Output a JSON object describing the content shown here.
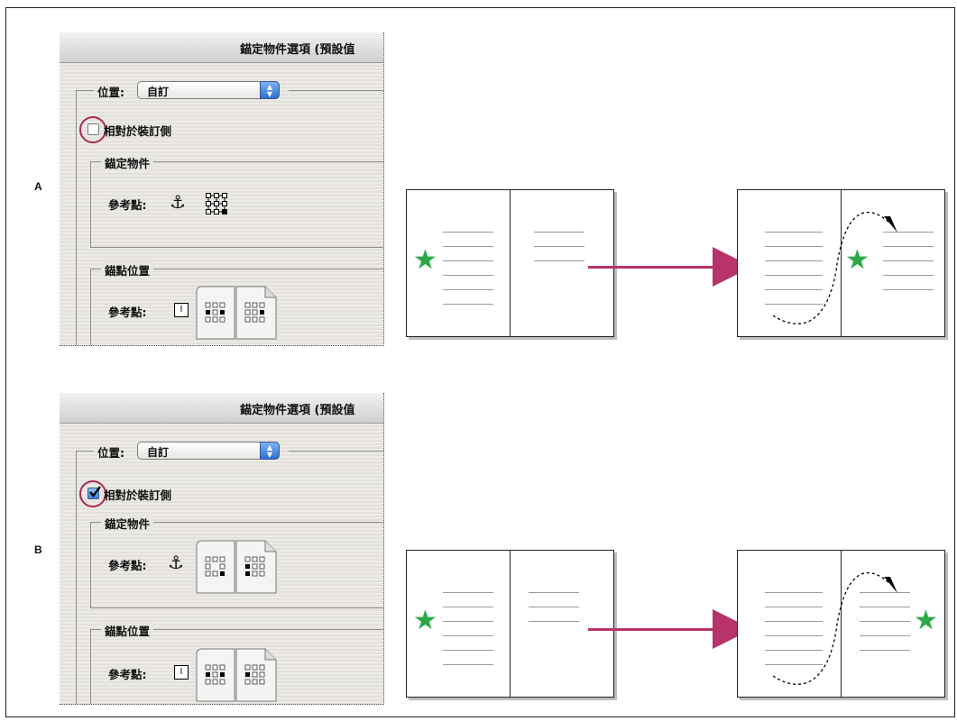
{
  "labels": {
    "a": "A",
    "b": "B"
  },
  "dialog": {
    "title": "錨定物件選項 (預設值",
    "position_label": "位置:",
    "position_value": "自訂",
    "relative_to_spine_label": "相對於裝訂側",
    "anchored_object_group": "錨定物件",
    "anchor_point_group": "錨點位置",
    "reference_point_label": "參考點:"
  },
  "panel_a": {
    "relative_to_spine_checked": false
  },
  "panel_b": {
    "relative_to_spine_checked": true
  },
  "colors": {
    "star": "#2ba84a",
    "arrow": "#b8336a",
    "highlight_ring": "#a52a5a"
  },
  "icons": [
    "anchor-icon",
    "star-icon",
    "arrow-right-icon",
    "reference-point-grid-icon",
    "spread-proxy-icon",
    "text-cursor-icon"
  ]
}
